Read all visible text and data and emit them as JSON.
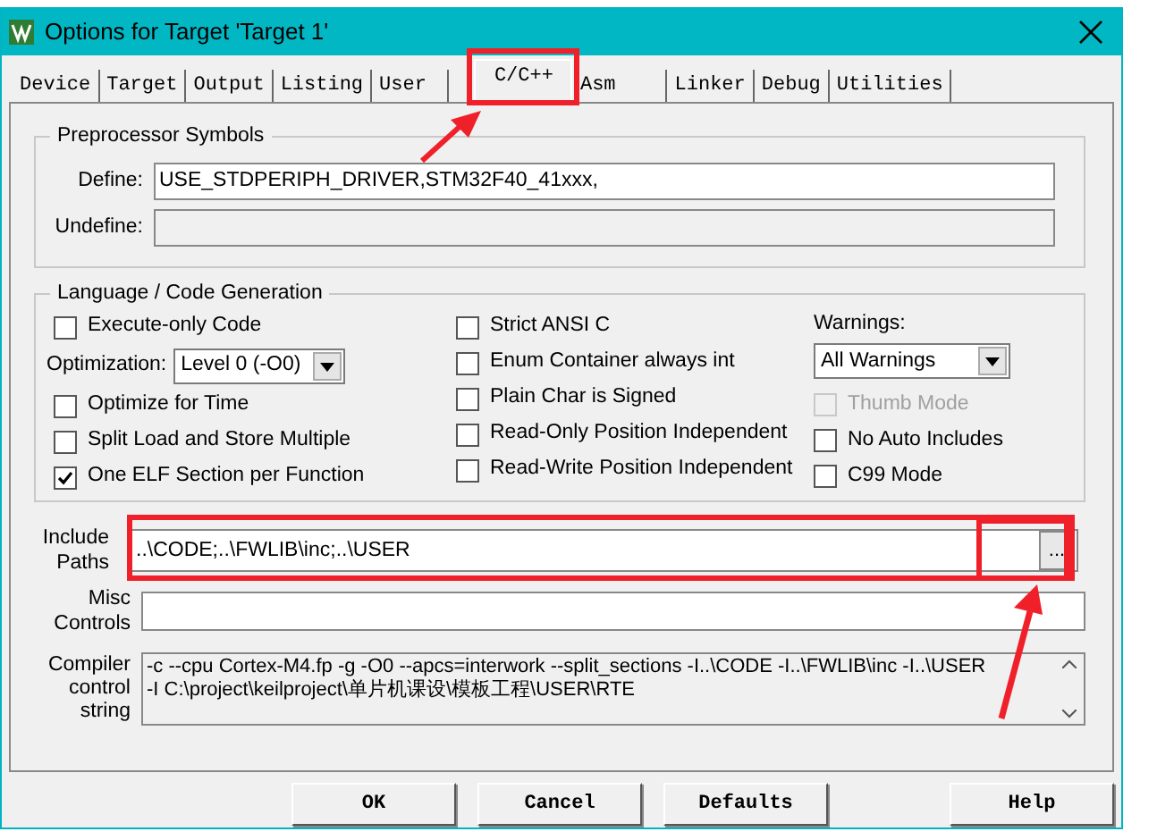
{
  "window": {
    "title": "Options for Target 'Target 1'"
  },
  "tabs": [
    {
      "label": "Device",
      "selected": false
    },
    {
      "label": "Target",
      "selected": false
    },
    {
      "label": "Output",
      "selected": false
    },
    {
      "label": "Listing",
      "selected": false
    },
    {
      "label": "User",
      "selected": false
    },
    {
      "label": "C/C++",
      "selected": true
    },
    {
      "label": "Asm",
      "selected": false
    },
    {
      "label": "Linker",
      "selected": false
    },
    {
      "label": "Debug",
      "selected": false
    },
    {
      "label": "Utilities",
      "selected": false
    }
  ],
  "preprocessor": {
    "title": "Preprocessor Symbols",
    "define": {
      "label": "Define:",
      "value": "USE_STDPERIPH_DRIVER,STM32F40_41xxx,",
      "disabled": false
    },
    "undefine": {
      "label": "Undefine:",
      "disabled": true
    }
  },
  "language": {
    "title": "Language / Code Generation",
    "columns": [
      [
        {
          "kind": "checkbox",
          "label": "Execute-only Code",
          "checked": false,
          "disabled": false
        },
        {
          "kind": "select",
          "label": "Optimization:",
          "value": "Level 0 (-O0)"
        },
        {
          "kind": "checkbox",
          "label": "Optimize for Time",
          "checked": false,
          "disabled": false
        },
        {
          "kind": "checkbox",
          "label": "Split Load and Store Multiple",
          "checked": false,
          "disabled": false
        },
        {
          "kind": "checkbox",
          "label": "One ELF Section per Function",
          "checked": true,
          "disabled": false
        }
      ],
      [
        {
          "kind": "checkbox",
          "label": "Strict ANSI C",
          "checked": false,
          "disabled": false
        },
        {
          "kind": "checkbox",
          "label": "Enum Container always int",
          "checked": false,
          "disabled": false
        },
        {
          "kind": "checkbox",
          "label": "Plain Char is Signed",
          "checked": false,
          "disabled": false
        },
        {
          "kind": "checkbox",
          "label": "Read-Only Position Independent",
          "checked": false,
          "disabled": false
        },
        {
          "kind": "checkbox",
          "label": "Read-Write Position Independent",
          "checked": false,
          "disabled": false
        }
      ],
      [
        {
          "kind": "stacked-select",
          "label": "Warnings:",
          "value": "All Warnings"
        },
        {
          "kind": "checkbox",
          "label": "Thumb Mode",
          "checked": false,
          "disabled": true
        },
        {
          "kind": "checkbox",
          "label": "No Auto Includes",
          "checked": false,
          "disabled": false
        },
        {
          "kind": "checkbox",
          "label": "C99 Mode",
          "checked": false,
          "disabled": false
        }
      ]
    ]
  },
  "include_paths": {
    "label": "Include Paths",
    "value": "..\\CODE;..\\FWLIB\\inc;..\\USER",
    "browse_button": "..."
  },
  "misc_controls": {
    "label": "Misc Controls"
  },
  "compiler_string": {
    "label": "Compiler control string",
    "lines": [
      "-c --cpu Cortex-M4.fp -g -O0 --apcs=interwork --split_sections -I..\\CODE -I..\\FWLIB\\inc -I..\\USER",
      "-I C:\\project\\keilproject\\单片机课设\\模板工程\\USER\\RTE"
    ]
  },
  "buttons": [
    "OK",
    "Cancel",
    "Defaults",
    "Help"
  ]
}
